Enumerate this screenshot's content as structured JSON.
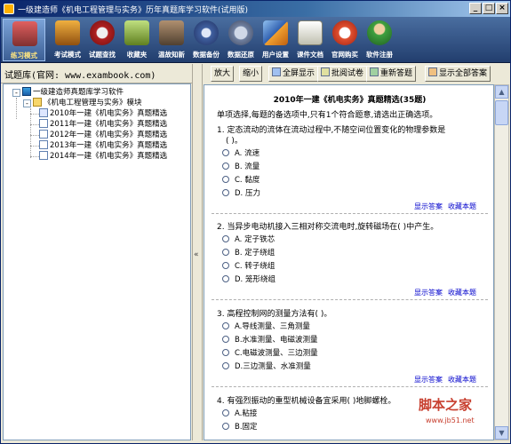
{
  "window": {
    "title": "一级建造师《机电工程管理与实务》历年真题库学习软件(试用版)",
    "minimize": "_",
    "maximize": "□",
    "close": "×"
  },
  "toolbar": {
    "items": [
      {
        "label": "练习模式",
        "icon": "books-icon",
        "color": "#c04040"
      },
      {
        "label": "考试模式",
        "icon": "exam-icon",
        "color": "#e08020"
      },
      {
        "label": "试题查找",
        "icon": "search-icon",
        "color": "#b02020"
      },
      {
        "label": "收藏夹",
        "icon": "favorites-icon",
        "color": "#80b040"
      },
      {
        "label": "温故知新",
        "icon": "review-icon",
        "color": "#806040"
      },
      {
        "label": "数据备份",
        "icon": "backup-icon",
        "color": "#4060a0"
      },
      {
        "label": "数据还原",
        "icon": "restore-icon",
        "color": "#7080a0"
      },
      {
        "label": "用户设置",
        "icon": "settings-icon",
        "color": "#6090d0"
      },
      {
        "label": "课件文档",
        "icon": "document-icon",
        "color": "#d0d0c0"
      },
      {
        "label": "官网购买",
        "icon": "ie-icon",
        "color": "#d04020"
      },
      {
        "label": "软件注册",
        "icon": "users-icon",
        "color": "#40a040"
      }
    ]
  },
  "left": {
    "header": "试题库(官网: www.exambook.com)",
    "tree": {
      "root": "一级建造师真题库学习软件",
      "module": "《机电工程管理与实务》模块",
      "papers": [
        "2010年一建《机电实务》真题精选",
        "2011年一建《机电实务》真题精选",
        "2012年一建《机电实务》真题精选",
        "2013年一建《机电实务》真题精选",
        "2014年一建《机电实务》真题精选"
      ]
    }
  },
  "splitter": "«",
  "actions": {
    "zoom_in": "放大",
    "zoom_out": "缩小",
    "show_all": "全屏显示",
    "grade": "批阅试卷",
    "redo": "重新答题",
    "show_answers": "显示全部答案"
  },
  "paper": {
    "title": "2010年一建《机电实务》真题精选(35题)",
    "instruction": "单项选择,每题的备选项中,只有1个符合题意,请选出正确选项。",
    "show_answer": "显示答案",
    "favorite": "收藏本题",
    "questions": [
      {
        "line1": "1. 定态流动的流体在流动过程中,不随空间位置变化的物理参数是",
        "line2": "(  )。",
        "options": [
          "A. 流速",
          "B. 流量",
          "C. 黏度",
          "D. 压力"
        ]
      },
      {
        "line1": "2. 当异步电动机接入三相对称交流电时,旋转磁场在(  )中产生。",
        "options": [
          "A. 定子铁芯",
          "B. 定子绕组",
          "C. 转子绕组",
          "D. 笼形绕组"
        ]
      },
      {
        "line1": "3. 高程控制网的测量方法有(  )。",
        "options": [
          "A.导线测量、三角测量",
          "B.水准测量、电磁波测量",
          "C.电磁波测量、三边测量",
          "D.三边测量、水准测量"
        ]
      },
      {
        "line1": "4. 有强烈振动的重型机械设备宜采用(  )地脚螺栓。",
        "options": [
          "A.粘接",
          "B.固定"
        ]
      }
    ]
  },
  "watermark": {
    "main": "脚本之家",
    "sub": "www.jb51.net"
  }
}
